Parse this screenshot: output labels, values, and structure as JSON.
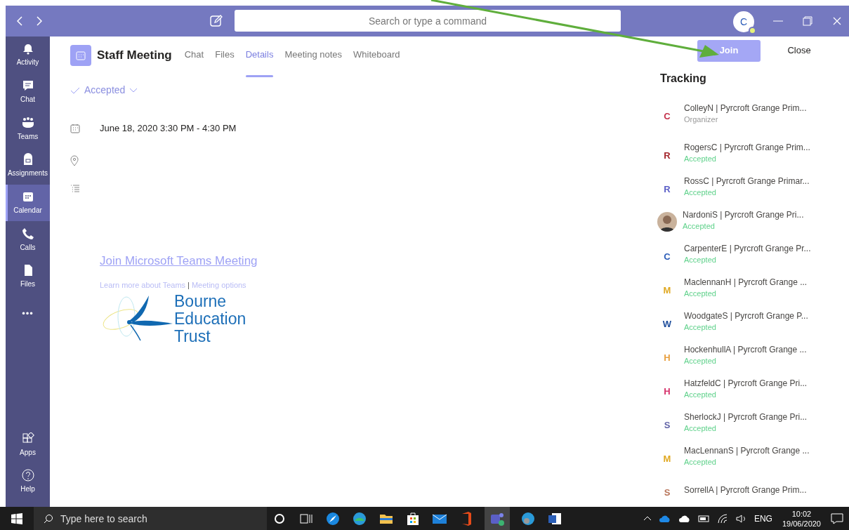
{
  "titlebar": {
    "search": {
      "placeholder": "Search or type a command"
    },
    "avatar": "C"
  },
  "sidebar": {
    "items": [
      {
        "label": "Activity",
        "selected": false
      },
      {
        "label": "Chat",
        "selected": false
      },
      {
        "label": "Teams",
        "selected": false
      },
      {
        "label": "Assignments",
        "selected": false
      },
      {
        "label": "Calendar",
        "selected": true
      },
      {
        "label": "Calls",
        "selected": false
      },
      {
        "label": "Files",
        "selected": false
      }
    ],
    "more": "•••",
    "bottom_items": [
      {
        "label": "Apps"
      },
      {
        "label": "Help"
      }
    ]
  },
  "meeting": {
    "title": "Staff Meeting",
    "tabs": [
      {
        "label": "Chat",
        "selected": false
      },
      {
        "label": "Files",
        "selected": false
      },
      {
        "label": "Details",
        "selected": true
      },
      {
        "label": "Meeting notes",
        "selected": false
      },
      {
        "label": "Whiteboard",
        "selected": false
      }
    ],
    "response": "Accepted",
    "date": "June 18, 2020 3:30 PM - 4:30 PM",
    "join_link": "Join Microsoft Teams Meeting",
    "learn_more": "Learn more about Teams",
    "separator": "|",
    "options_link": "Meeting options",
    "logo_lines": [
      "Bourne",
      "Education",
      "Trust"
    ],
    "buttons": [
      {
        "label": "Join",
        "kind": "primary"
      },
      {
        "label": "Close",
        "kind": "plain"
      }
    ]
  },
  "tracking": {
    "title": "Tracking",
    "attendees": [
      {
        "initial": "C",
        "kind": "initial",
        "color": "#c4314b",
        "name": "ColleyN | Pyrcroft Grange Prim...",
        "status": "Organizer"
      },
      {
        "initial": "R",
        "kind": "initial",
        "color": "#a4262c",
        "name": "RogersC | Pyrcroft Grange Prim...",
        "status": "Accepted"
      },
      {
        "initial": "R",
        "kind": "initial",
        "color": "#5b5fc7",
        "name": "RossC | Pyrcroft Grange Primar...",
        "status": "Accepted"
      },
      {
        "kind": "photo",
        "name": "NardoniS | Pyrcroft Grange Pri...",
        "status": "Accepted"
      },
      {
        "initial": "C",
        "kind": "initial",
        "color": "#2b5cb8",
        "name": "CarpenterE | Pyrcroft Grange Pr...",
        "status": "Accepted"
      },
      {
        "initial": "M",
        "kind": "initial",
        "color": "#e0a820",
        "name": "MaclennanH | Pyrcroft Grange ...",
        "status": "Accepted"
      },
      {
        "initial": "W",
        "kind": "initial",
        "color": "#1f4e9c",
        "name": "WoodgateS | Pyrcroft Grange P...",
        "status": "Accepted"
      },
      {
        "initial": "H",
        "kind": "initial",
        "color": "#e8a040",
        "name": "HockenhullA | Pyrcroft Grange ...",
        "status": "Accepted"
      },
      {
        "initial": "H",
        "kind": "initial",
        "color": "#d6336c",
        "name": "HatzfeldC | Pyrcroft Grange Pri...",
        "status": "Accepted"
      },
      {
        "initial": "S",
        "kind": "initial",
        "color": "#6264a7",
        "name": "SherlockJ | Pyrcroft Grange Pri...",
        "status": "Accepted"
      },
      {
        "initial": "M",
        "kind": "initial",
        "color": "#e0a820",
        "name": "MacLennanS | Pyrcroft Grange ...",
        "status": "Accepted"
      },
      {
        "initial": "S",
        "kind": "initial",
        "color": "#b8755a",
        "name": "SorrellA | Pyrcroft Grange Prim..."
      }
    ]
  },
  "taskbar": {
    "search": {
      "placeholder": "Type here to search"
    },
    "language": "ENG",
    "time": "10:02",
    "date": "19/06/2020"
  }
}
